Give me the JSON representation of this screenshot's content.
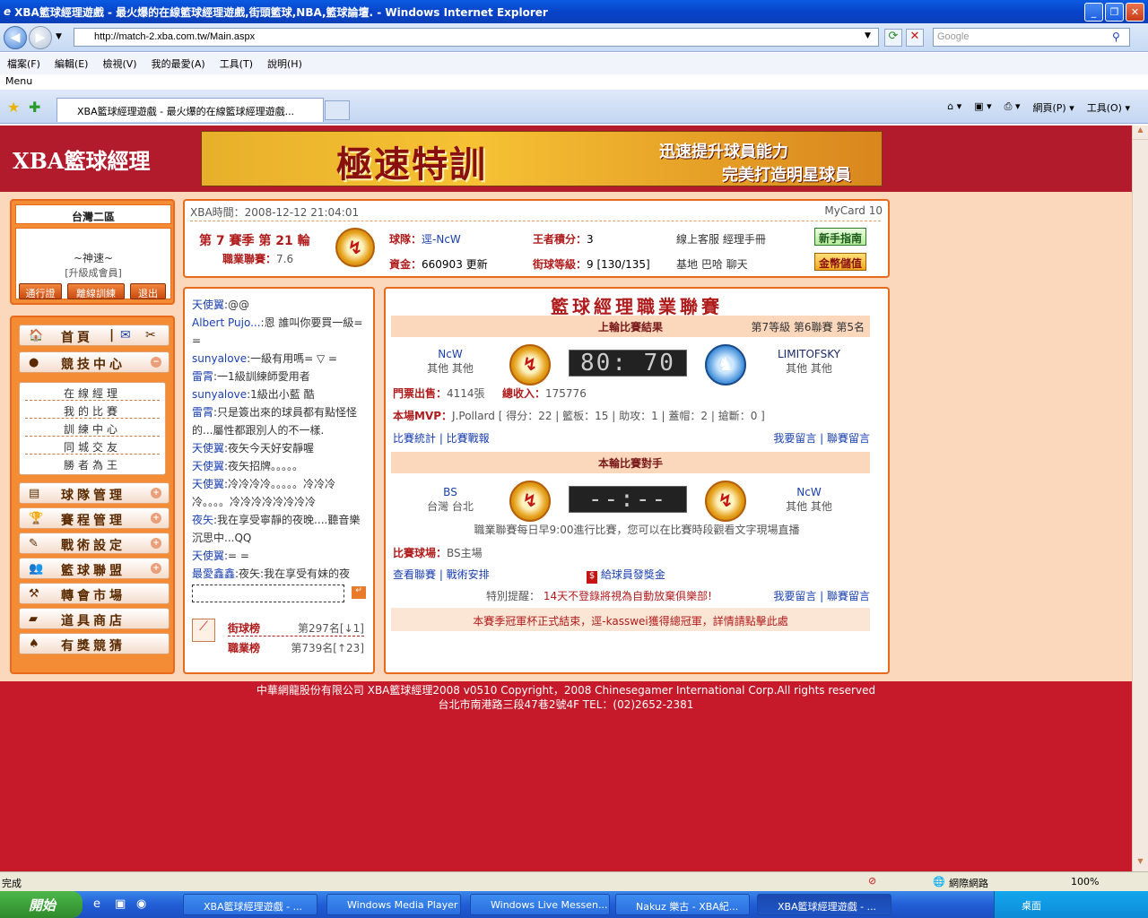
{
  "browser": {
    "window_title": "XBA籃球經理遊戲 - 最火爆的在線籃球經理遊戲,街頭籃球,NBA,籃球論壇. - Windows Internet Explorer",
    "url": "http://match-2.xba.com.tw/Main.aspx",
    "search_placeholder": "Google",
    "menu": [
      "檔案(F)",
      "編輯(E)",
      "檢視(V)",
      "我的最愛(A)",
      "工具(T)",
      "說明(H)"
    ],
    "menu_label": "Menu",
    "tab_title": "XBA籃球經理遊戲 - 最火爆的在線籃球經理遊戲...",
    "tools": [
      "網頁(P) ▾",
      "工具(O) ▾"
    ],
    "status": "完成",
    "zone": "網際網路",
    "zoom": "100%"
  },
  "header": {
    "logo": "XBA籃球經理",
    "banner_main": "極速特訓",
    "banner_line1": "迅速提升球員能力",
    "banner_line2": "完美打造明星球員"
  },
  "user": {
    "region": "台灣二區",
    "name": "~神速~",
    "level": "[升級成會員]",
    "buttons": [
      "通行證",
      "離線訓練",
      "退出"
    ]
  },
  "nav": {
    "home": "首頁",
    "sep": "|",
    "competition": "競技中心",
    "sub": [
      "在線經理",
      "我的比賽",
      "訓練中心",
      "同城交友",
      "勝者為王"
    ],
    "items": [
      "球隊管理",
      "賽程管理",
      "戰術設定",
      "籃球聯盟",
      "轉會市場",
      "道具商店",
      "有獎競猜"
    ]
  },
  "info": {
    "time": "XBA時間：2008-12-12 21:04:01",
    "mycard": "MyCard 10",
    "season": "第 7 賽季 第 21 輪",
    "pro_label": "職業聯賽：",
    "pro_value": "7.6",
    "team_label": "球隊：",
    "team_value": "逕-NcW",
    "king_label": "王者積分：",
    "king_value": "3",
    "cs": "線上客服  經理手冊",
    "newbie": "新手指南",
    "funds_label": "資金：",
    "funds_value": "660903 更新",
    "street_label": "街球等級：",
    "street_value": "9 [130/135]",
    "base": "基地  巴哈  聊天",
    "gold": "金幣儲值"
  },
  "chat": [
    {
      "name": "天使翼",
      "text": ":@@"
    },
    {
      "name": "Albert Pujo...",
      "text": ":恩  誰叫你要買一級= ="
    },
    {
      "name": "sunyalove",
      "text": ":一級有用嗎= ▽ ="
    },
    {
      "name": "雷霄",
      "text": ":一1級訓練師愛用者"
    },
    {
      "name": "sunyalove",
      "text": ":1級出小藍 酷"
    },
    {
      "name": "雷霄",
      "text": ":只是簽出來的球員都有點怪怪的...屬性都跟別人的不一樣."
    },
    {
      "name": "天使翼",
      "text": ":夜矢今天好安靜喔"
    },
    {
      "name": "天使翼",
      "text": ":夜矢招牌。。。。。"
    },
    {
      "name": "天使翼",
      "text": ":冷冷冷冷。。。。。冷冷冷冷。。。。冷冷冷冷冷冷冷冷"
    },
    {
      "name": "夜矢",
      "text": ":我在享受寧靜的夜晚....聽音樂沉思中...QQ"
    },
    {
      "name": "天使翼",
      "text": ":=     ="
    },
    {
      "name": "最愛鑫鑫",
      "text": ":夜矢:我在享受有妹的夜晚..."
    }
  ],
  "ranks": {
    "street_label": "街球榜",
    "street_value": "第297名[↓1]",
    "pro_label": "職業榜",
    "pro_value": "第739名[↑23]"
  },
  "match": {
    "title": "籃球經理職業聯賽",
    "last_label": "上輪比賽結果",
    "last_meta": "第7等級  第6聯賽  第5名",
    "home_team": "NcW",
    "home_loc": "其他  其他",
    "away_team": "LIMITOFSKY",
    "away_loc": "其他  其他",
    "score": "80: 70",
    "tickets_label": "門票出售：",
    "tickets_value": "4114張",
    "income_label": "總收入：",
    "income_value": "175776",
    "mvp_label": "本場MVP：",
    "mvp_value": "J.Pollard  [ 得分：22 | 籃板：15 | 助攻：1 | 蓋帽：2 | 搶斷：0 ]",
    "stats_links": "比賽統計 | 比賽戰報",
    "msg_links": "我要留言 | 聯賽留言",
    "next_label": "本輪比賽對手",
    "next_home": "BS",
    "next_home_loc": "台灣  台北",
    "next_away": "NcW",
    "next_away_loc": "其他  其他",
    "next_score": "--:--",
    "schedule_note": "職業聯賽每日早9:00進行比賽，您可以在比賽時段觀看文字現場直播",
    "venue_label": "比賽球場：",
    "venue_value": "BS主場",
    "view_links": "查看聯賽 | 戰術安排",
    "bonus": "給球員發獎金",
    "warning_label": "特別提醒：",
    "warning_text": "14天不登錄將視為自動放棄俱樂部!",
    "msg_links2": "我要留言 | 聯賽留言",
    "notice": "本賽季冠軍杯正式結束，逕-kasswei獲得總冠軍，詳情請點擊此處"
  },
  "footer": {
    "line1": "中華網龍股份有限公司  XBA籃球經理2008 v0510     Copyright，2008 Chinesegamer International Corp.All rights reserved",
    "line2": "台北市南港路三段47巷2號4F TEL：(02)2652-2381"
  },
  "taskbar": {
    "start": "開始",
    "tasks": [
      "XBA籃球經理遊戲 - ...",
      "Windows Media Player",
      "Windows Live Messen...",
      "Nakuz 樂古 - XBA紀...",
      "XBA籃球經理遊戲 - ..."
    ],
    "tray": "桌面"
  }
}
